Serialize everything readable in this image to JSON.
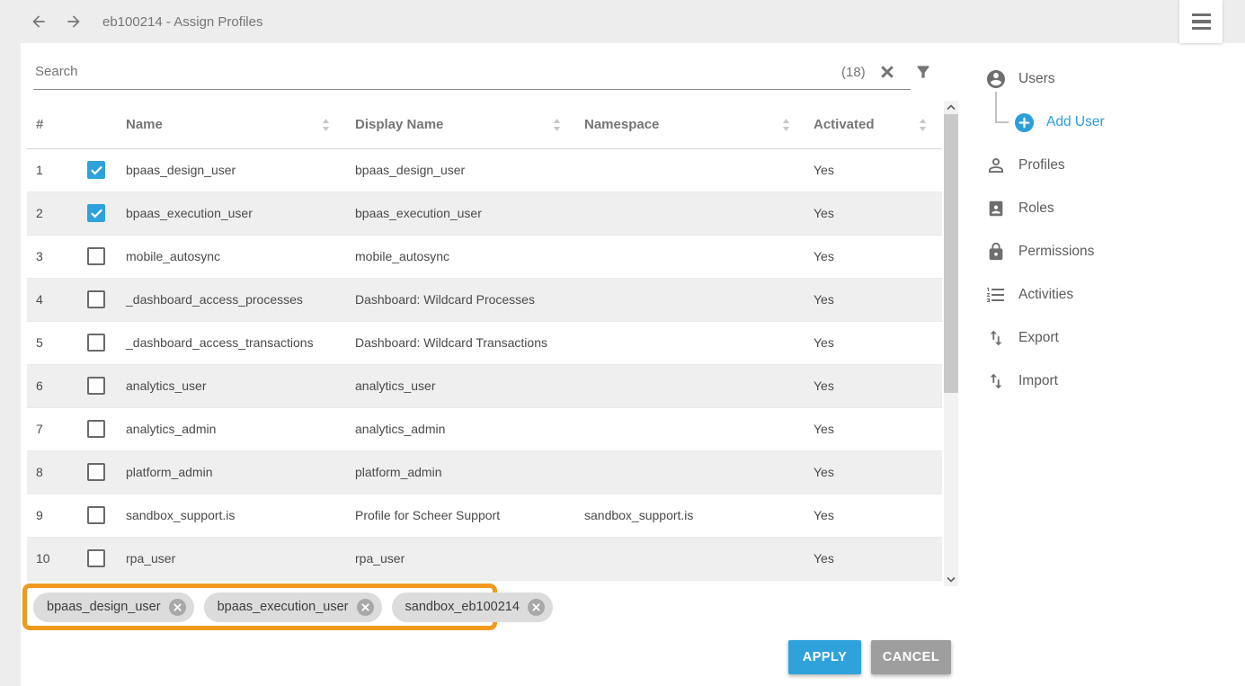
{
  "topbar": {
    "title": "eb100214 - Assign Profiles"
  },
  "search": {
    "placeholder": "Search",
    "count": "(18)"
  },
  "table": {
    "columns": [
      "#",
      "Name",
      "Display Name",
      "Namespace",
      "Activated"
    ],
    "rows": [
      {
        "num": "1",
        "checked": true,
        "name": "bpaas_design_user",
        "display_name": "bpaas_design_user",
        "namespace": "",
        "activated": "Yes"
      },
      {
        "num": "2",
        "checked": true,
        "name": "bpaas_execution_user",
        "display_name": "bpaas_execution_user",
        "namespace": "",
        "activated": "Yes"
      },
      {
        "num": "3",
        "checked": false,
        "name": "mobile_autosync",
        "display_name": "mobile_autosync",
        "namespace": "",
        "activated": "Yes"
      },
      {
        "num": "4",
        "checked": false,
        "name": "_dashboard_access_processes",
        "display_name": "Dashboard: Wildcard Processes",
        "namespace": "",
        "activated": "Yes"
      },
      {
        "num": "5",
        "checked": false,
        "name": "_dashboard_access_transactions",
        "display_name": "Dashboard: Wildcard Transactions",
        "namespace": "",
        "activated": "Yes"
      },
      {
        "num": "6",
        "checked": false,
        "name": "analytics_user",
        "display_name": "analytics_user",
        "namespace": "",
        "activated": "Yes"
      },
      {
        "num": "7",
        "checked": false,
        "name": "analytics_admin",
        "display_name": "analytics_admin",
        "namespace": "",
        "activated": "Yes"
      },
      {
        "num": "8",
        "checked": false,
        "name": "platform_admin",
        "display_name": "platform_admin",
        "namespace": "",
        "activated": "Yes"
      },
      {
        "num": "9",
        "checked": false,
        "name": "sandbox_support.is",
        "display_name": "Profile for Scheer Support",
        "namespace": "sandbox_support.is",
        "activated": "Yes"
      },
      {
        "num": "10",
        "checked": false,
        "name": "rpa_user",
        "display_name": "rpa_user",
        "namespace": "",
        "activated": "Yes"
      }
    ]
  },
  "chips": [
    "bpaas_design_user",
    "bpaas_execution_user",
    "sandbox_eb100214"
  ],
  "footer": {
    "apply": "APPLY",
    "cancel": "CANCEL"
  },
  "sidebar": {
    "items": [
      {
        "label": "Users",
        "icon": "account-circle-icon",
        "indent": false,
        "accent": false
      },
      {
        "label": "Add User",
        "icon": "add-circle-icon",
        "indent": true,
        "accent": true
      },
      {
        "label": "Profiles",
        "icon": "person-outline-icon",
        "indent": false,
        "accent": false
      },
      {
        "label": "Roles",
        "icon": "badge-icon",
        "indent": false,
        "accent": false
      },
      {
        "label": "Permissions",
        "icon": "lock-icon",
        "indent": false,
        "accent": false
      },
      {
        "label": "Activities",
        "icon": "numbered-list-icon",
        "indent": false,
        "accent": false
      },
      {
        "label": "Export",
        "icon": "import-export-icon",
        "indent": false,
        "accent": false
      },
      {
        "label": "Import",
        "icon": "import-export-icon",
        "indent": false,
        "accent": false
      }
    ]
  },
  "colors": {
    "accent_blue": "#2fa2db",
    "link_blue": "#2b9fd9",
    "highlight_orange": "#f09a1f",
    "cancel_gray": "#9e9e9e",
    "topbar_gray": "#ededed",
    "row_alt_gray": "#efefef"
  }
}
